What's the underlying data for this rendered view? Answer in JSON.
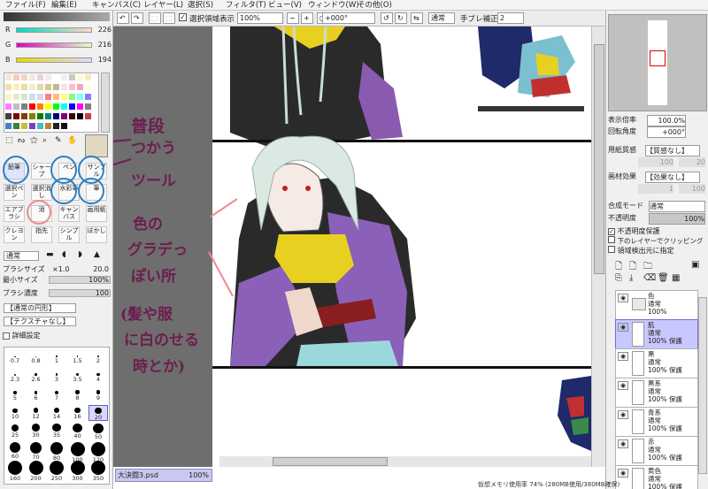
{
  "menubar": {
    "items": [
      "ファイル(F)",
      "編集(E)",
      "キャンバス(C)",
      "レイヤー(L)",
      "選択(S)",
      "フィルタ(T)",
      "ビュー(V)",
      "ウィンドウ(W)",
      "その他(O)"
    ]
  },
  "color": {
    "r_label": "R",
    "r_value": "226",
    "g_label": "G",
    "g_value": "216",
    "b_label": "B",
    "b_value": "194",
    "swatches": [
      "#f8e4dc",
      "#f4cdbd",
      "#ecd8c8",
      "#f4e8e0",
      "#e8d4d8",
      "#fce8ec",
      "#ffffff",
      "#f0f0f0",
      "#c8c8c8",
      "#fff8d8",
      "#f8e8c0",
      "#f0e0a8",
      "#f8f0c0",
      "#e8e0a0",
      "#f0f0d0",
      "#e0d8b0",
      "#d8c890",
      "#c0b890",
      "#fce0e8",
      "#f8c0d0",
      "#f0a8c0",
      "#ffffe0",
      "#f8f8c0",
      "#e8e8d0",
      "#d0e8c8",
      "#c8e0f0",
      "#d8d8f0",
      "#ff7f7f",
      "#ffbf7f",
      "#ffff7f",
      "#7fff7f",
      "#7fffff",
      "#7f7fff",
      "#ff7fff",
      "#bfbfbf",
      "#7f7f7f",
      "#ff0000",
      "#ff8000",
      "#ffff00",
      "#00ff00",
      "#00ffff",
      "#0000ff",
      "#ff00ff",
      "#808080",
      "#404040",
      "#800000",
      "#804000",
      "#808000",
      "#008000",
      "#008080",
      "#000080",
      "#800080",
      "#400000",
      "#000000",
      "#c0404a",
      "#4a80c0",
      "#408040",
      "#c0c040",
      "#8040c0",
      "#40c0c0",
      "#c08040",
      "#202020",
      "#101010"
    ]
  },
  "tools": {
    "cells": [
      {
        "label": "鉛筆",
        "sel": true
      },
      {
        "label": "シャープ"
      },
      {
        "label": "ペン"
      },
      {
        "label": "サンプル"
      },
      {
        "label": "選択ペン"
      },
      {
        "label": "選択消し"
      },
      {
        "label": "水彩筆"
      },
      {
        "label": "筆"
      },
      {
        "label": "エアブラシ"
      },
      {
        "label": "消"
      },
      {
        "label": "キャンバス"
      },
      {
        "label": "画用紙"
      },
      {
        "label": "クレヨン"
      },
      {
        "label": "指先"
      },
      {
        "label": "シンプル"
      },
      {
        "label": "ぼかし"
      }
    ]
  },
  "brush": {
    "mode": "通常",
    "size_label": "ブラシサイズ",
    "size_mult": "×1.0",
    "size_value": "20.0",
    "min_label": "最小サイズ",
    "min_value": "100%",
    "density_label": "ブラシ濃度",
    "density_value": "100",
    "shape": "【通常の円形】",
    "texture": "【テクスチャなし】",
    "detail": "詳細設定",
    "sizes": [
      "0.7",
      "0.8",
      "1",
      "1.5",
      "2",
      "2.3",
      "2.6",
      "3",
      "3.5",
      "4",
      "5",
      "6",
      "7",
      "8",
      "9",
      "10",
      "12",
      "14",
      "16",
      "20",
      "25",
      "30",
      "35",
      "40",
      "50",
      "60",
      "70",
      "80",
      "100",
      "120",
      "160",
      "200",
      "250",
      "300",
      "350"
    ]
  },
  "canvas_toolbar": {
    "checkbox_label": "選択領域表示",
    "zoom": "100%",
    "angle": "+000°",
    "blend": "通常",
    "stabilizer_label": "手ブレ補正",
    "stabilizer": "2"
  },
  "annotations": {
    "a1": "普段",
    "a2": "つかう",
    "a3": "ツール",
    "b1": "色の",
    "b2": "グラデっ",
    "b3": "ぽい所",
    "b4": "(髪や服",
    "b5": "に白のせる",
    "b6": "時とか)"
  },
  "file_tab": {
    "name": "大決闘3.psd",
    "zoom": "100%"
  },
  "right": {
    "zoom_label": "表示倍率",
    "zoom_value": "100.0%",
    "rotate_label": "回転角度",
    "rotate_value": "+000°",
    "paper_label": "用紙質感",
    "paper_value": "【質感なし】",
    "paper_s1": "100",
    "paper_s2": "20",
    "effect_label": "画材効果",
    "effect_value": "【効果なし】",
    "effect_s1": "1",
    "effect_s2": "100",
    "blend_label": "合成モード",
    "blend_value": "通常",
    "opacity_label": "不透明度",
    "opacity_value": "100%",
    "protect": "不透明度保護",
    "clip": "下のレイヤーでクリッピング",
    "select_src": "領域検出元に指定",
    "layers": [
      {
        "name": "色",
        "mode": "通常",
        "op": "100%",
        "folder": true
      },
      {
        "name": "肌",
        "mode": "通常",
        "op": "100% 保護",
        "sel": true
      },
      {
        "name": "黒",
        "mode": "通常",
        "op": "100% 保護"
      },
      {
        "name": "黒系",
        "mode": "通常",
        "op": "100% 保護"
      },
      {
        "name": "青系",
        "mode": "通常",
        "op": "100% 保護"
      },
      {
        "name": "赤",
        "mode": "通常",
        "op": "100% 保護"
      },
      {
        "name": "黄色",
        "mode": "通常",
        "op": "100% 保護"
      }
    ]
  },
  "status": {
    "text": "仮想メモリ使用率 74% (280MB使用/380MB確保)"
  },
  "colors": {
    "accent": "#7070d0",
    "annotation": "#6b1e4e",
    "circle": "#2f7fbf"
  }
}
